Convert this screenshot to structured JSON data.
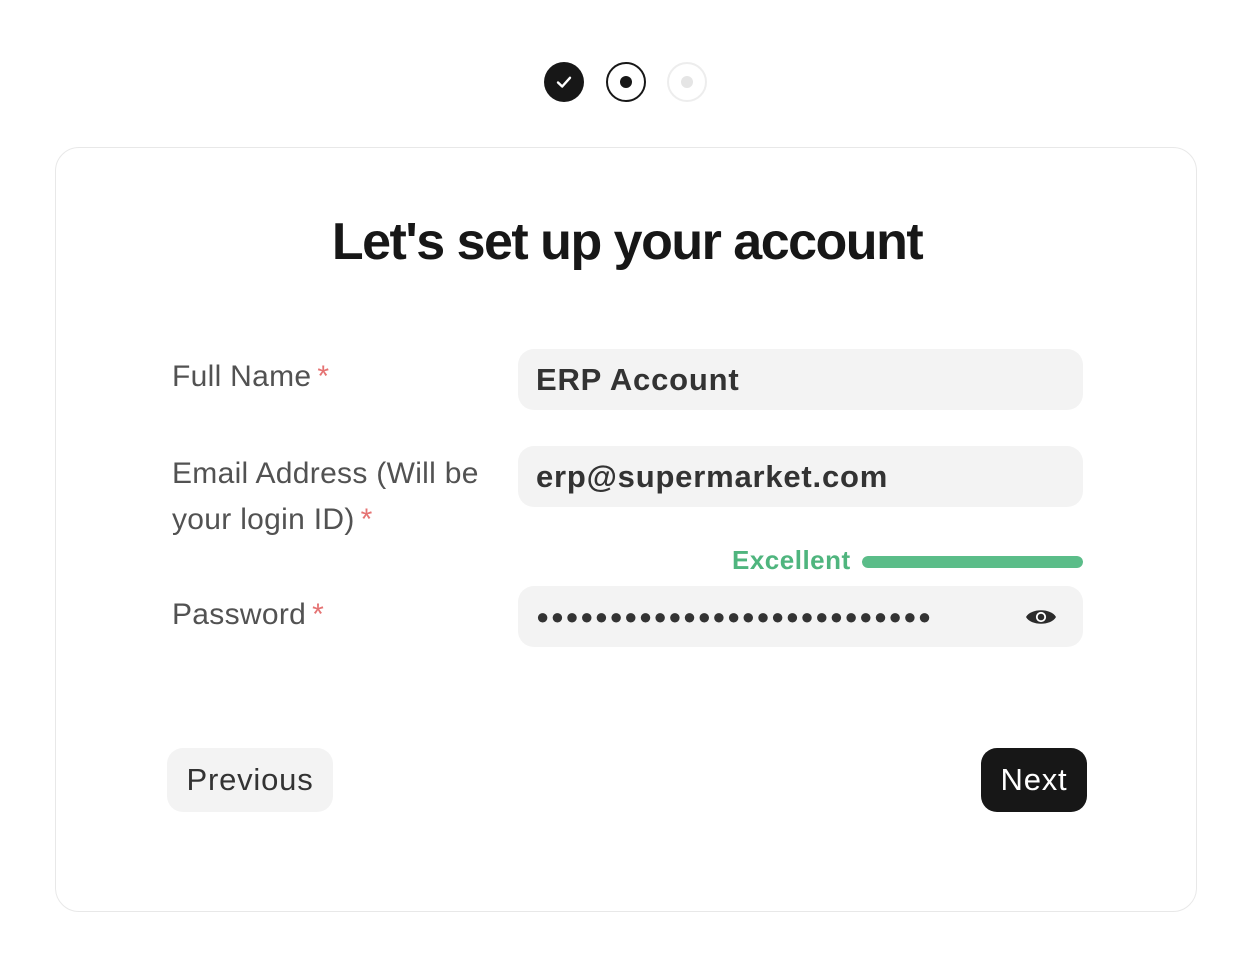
{
  "stepper": {
    "steps": [
      {
        "state": "completed",
        "icon": "check-icon"
      },
      {
        "state": "current",
        "icon": "dot-icon"
      },
      {
        "state": "upcoming",
        "icon": "dot-icon"
      }
    ]
  },
  "form": {
    "title": "Let's set up your account",
    "required_marker": "*",
    "fields": {
      "full_name": {
        "label": "Full Name",
        "value": "ERP Account"
      },
      "email": {
        "label": "Email Address (Will be your login ID)",
        "value": "erp@supermarket.com"
      },
      "password": {
        "label": "Password",
        "value": "●●●●●●●●●●●●●●●●●●●●●●●●●●●",
        "toggle_icon": "eye-icon"
      }
    },
    "password_strength": {
      "label": "Excellent",
      "level": 1.0,
      "color": "#5bbd89"
    }
  },
  "actions": {
    "previous_label": "Previous",
    "next_label": "Next"
  },
  "colors": {
    "primary": "#171717",
    "input_bg": "#f3f3f3",
    "required": "#e57373",
    "strength": "#4fb57e"
  }
}
